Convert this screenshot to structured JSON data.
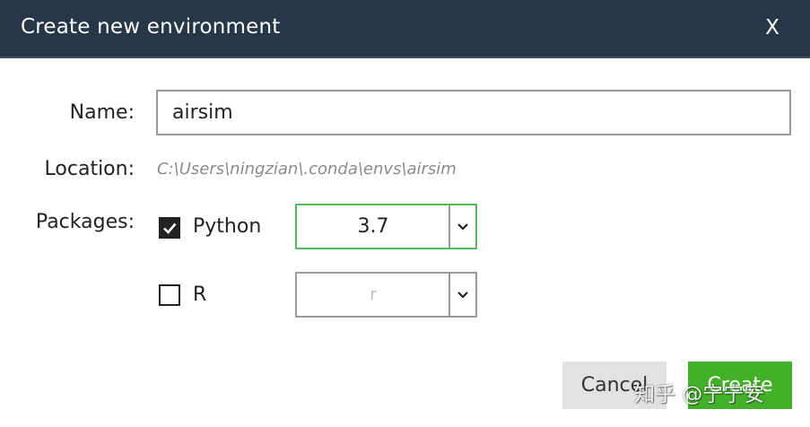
{
  "dialog": {
    "title": "Create new environment",
    "close_label": "X"
  },
  "form": {
    "name_label": "Name:",
    "name_value": "airsim",
    "location_label": "Location:",
    "location_value": "C:\\Users\\ningzian\\.conda\\envs\\airsim",
    "packages_label": "Packages:",
    "packages": [
      {
        "label": "Python",
        "checked": true,
        "version": "3.7",
        "enabled": true
      },
      {
        "label": "R",
        "checked": false,
        "version": "r",
        "enabled": false
      }
    ]
  },
  "buttons": {
    "cancel_label": "Cancel",
    "create_label": "Create"
  },
  "watermark": "知乎 @宁宁安",
  "colors": {
    "titlebar": "#263747",
    "accent_green": "#43b02a",
    "active_border": "#5cb85c"
  },
  "icons": [
    "close-icon",
    "checkmark-icon",
    "chevron-down-icon"
  ]
}
